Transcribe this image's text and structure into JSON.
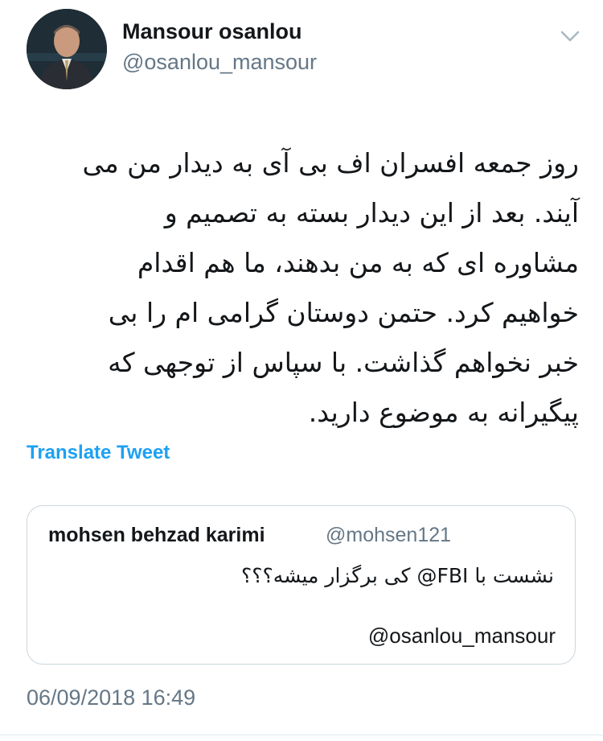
{
  "author": {
    "name": "Mansour osanlou",
    "handle": "@osanlou_mansour"
  },
  "tweet": {
    "lines": [
      "روز جمعه افسران اف بی آی به دیدار من می",
      "آیند. بعد از این دیدار بسته به تصمیم و",
      "مشاوره ای که به من بدهند، ما هم اقدام",
      "خواهیم کرد. حتمن دوستان گرامی ام را بی",
      "خبر نخواهم گذاشت. با سپاس از توجهی که",
      "پیگیرانه به موضوع دارید."
    ],
    "translate_label": "Translate Tweet",
    "timestamp": "06/09/2018 16:49"
  },
  "quoted": {
    "name": "mohsen behzad karimi",
    "handle": "@mohsen121",
    "text": "نشست با FBI@ کی برگزار میشه؟؟؟",
    "mention": "@osanlou_mansour"
  },
  "icons": {
    "menu": "chevron-down-icon"
  },
  "colors": {
    "link": "#1da1f2",
    "secondary_text": "#657786",
    "border": "#ccd6dd"
  }
}
